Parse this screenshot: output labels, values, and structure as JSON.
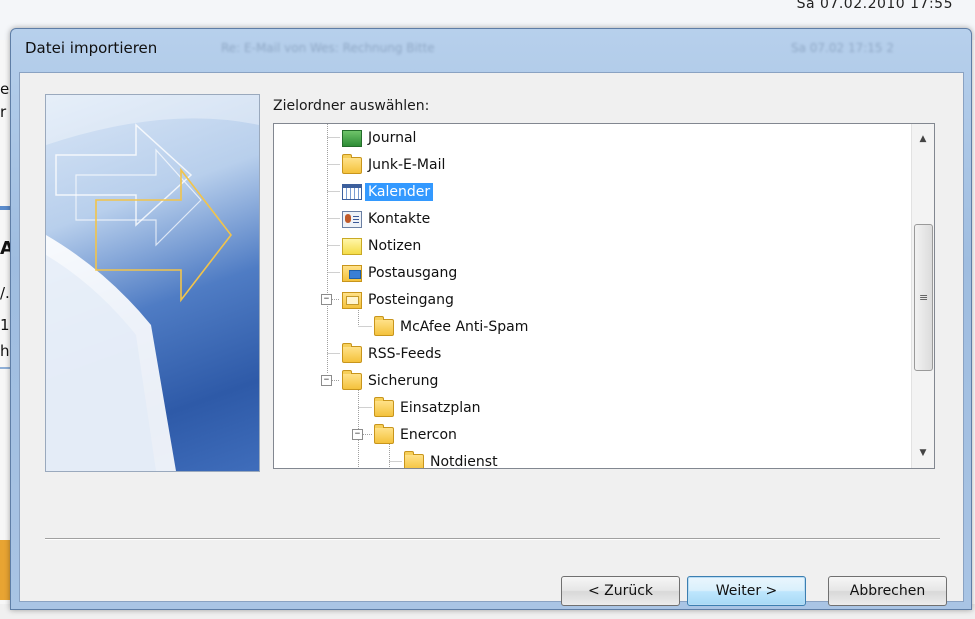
{
  "background": {
    "datetime": "Sa 07.02.2010 17:55",
    "left_fragments": [
      "e",
      "r",
      "A",
      "/.",
      "1",
      "h"
    ]
  },
  "dialog": {
    "title": "Datei importieren",
    "ghost_title_1": "Re: E-Mail von Wes: Rechnung Bitte",
    "ghost_title_2": "Sa 07.02 17:15 2"
  },
  "prompt": "Zielordner auswählen:",
  "tree": {
    "items": [
      {
        "label": "Journal",
        "icon": "journal-icon"
      },
      {
        "label": "Junk-E-Mail",
        "icon": "folder-icon"
      },
      {
        "label": "Kalender",
        "icon": "calendar-icon",
        "selected": true
      },
      {
        "label": "Kontakte",
        "icon": "contacts-icon"
      },
      {
        "label": "Notizen",
        "icon": "notes-icon"
      },
      {
        "label": "Postausgang",
        "icon": "outbox-icon"
      },
      {
        "label": "Posteingang",
        "icon": "inbox-icon",
        "expanded": true
      },
      {
        "label": "McAfee Anti-Spam",
        "icon": "folder-icon"
      },
      {
        "label": "RSS-Feeds",
        "icon": "folder-icon"
      },
      {
        "label": "Sicherung",
        "icon": "folder-icon",
        "expanded": true
      },
      {
        "label": "Einsatzplan",
        "icon": "folder-icon"
      },
      {
        "label": "Enercon",
        "icon": "folder-icon",
        "expanded": true
      },
      {
        "label": "Notdienst",
        "icon": "folder-icon"
      }
    ],
    "expander_symbol": "−",
    "scroll_up": "▲",
    "scroll_down": "▼",
    "scroll_grip": "≡"
  },
  "buttons": {
    "back": "< Zurück",
    "next": "Weiter >",
    "cancel": "Abbrechen"
  },
  "colors": {
    "selection": "#3399ff",
    "frame": "#a7c3e3",
    "client": "#f0f0f0"
  }
}
